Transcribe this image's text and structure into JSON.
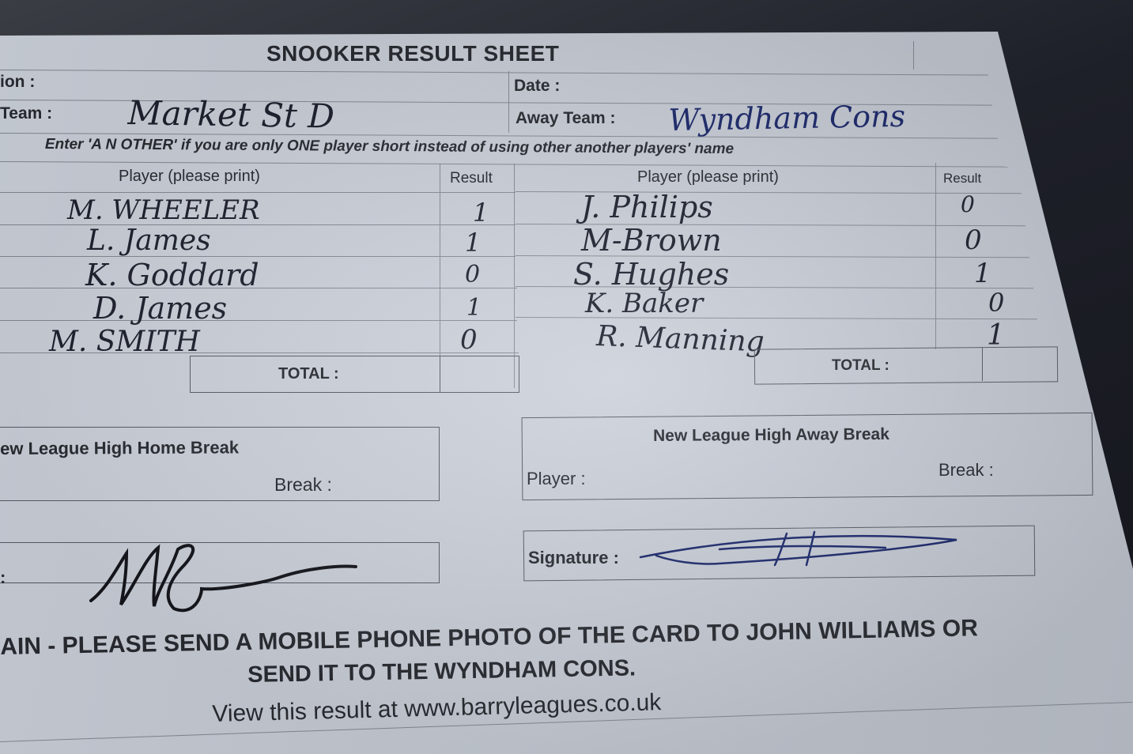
{
  "title": "SNOOKER RESULT SHEET",
  "labels": {
    "division": "ion :",
    "date": "Date :",
    "home_team": "Team :",
    "away_team": "Away Team :",
    "instruction": "Enter 'A N OTHER' if you are only ONE player short instead of using other another players' name",
    "player_header_home": "Player (please print)",
    "result_header_home": "Result",
    "player_header_away": "Player (please print)",
    "result_header_away": "Result",
    "total_home": "TOTAL :",
    "total_away": "TOTAL :",
    "home_break_title": "ew League High Home Break",
    "home_break_label": "Break :",
    "away_break_title": "New League High Away Break",
    "away_player_label": "Player :",
    "away_break_label": "Break :",
    "home_signature": ": ",
    "away_signature": "Signature :",
    "footer_line1": "AIN - PLEASE SEND A MOBILE PHONE PHOTO OF THE CARD TO JOHN WILLIAMS OR",
    "footer_line2": "SEND IT TO THE WYNDHAM CONS.",
    "footer_line3": "View this result at www.barryleagues.co.uk"
  },
  "handwritten": {
    "home_team": "Market St D",
    "away_team": "Wyndham Cons"
  },
  "home_players": [
    {
      "name": "M. WHEELER",
      "result": "1"
    },
    {
      "name": "L. James",
      "result": "1"
    },
    {
      "name": "K. Goddard",
      "result": "0"
    },
    {
      "name": "D. James",
      "result": "1"
    },
    {
      "name": "M. SMITH",
      "result": "0"
    }
  ],
  "away_players": [
    {
      "name": "J. Philips",
      "result": "0"
    },
    {
      "name": "M-Brown",
      "result": "0"
    },
    {
      "name": "S. Hughes",
      "result": "1"
    },
    {
      "name": "K. Baker",
      "result": "0"
    },
    {
      "name": "R. Manning",
      "result": "1"
    }
  ],
  "colors": {
    "paper": "#d2d7e1",
    "print_ink": "#2a2d33",
    "pen_black": "#1f2230",
    "pen_blue": "#1d2a6e"
  }
}
